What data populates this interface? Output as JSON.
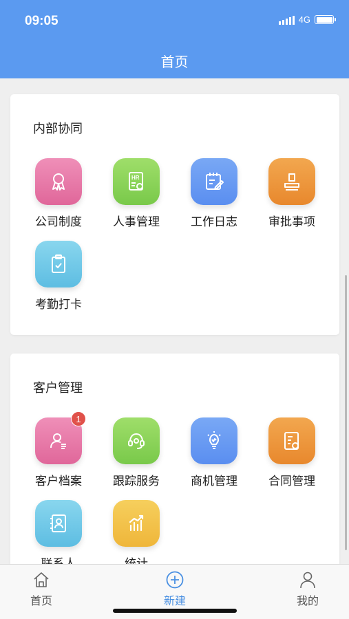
{
  "status_bar": {
    "time": "09:05",
    "network": "4G"
  },
  "header": {
    "title": "首页"
  },
  "sections": [
    {
      "title": "内部协同",
      "items": [
        {
          "label": "公司制度",
          "icon": "award-ribbon-icon",
          "color": "#e67aa8"
        },
        {
          "label": "人事管理",
          "icon": "hr-document-icon",
          "color": "#86d157"
        },
        {
          "label": "工作日志",
          "icon": "notepad-edit-icon",
          "color": "#689af2"
        },
        {
          "label": "审批事项",
          "icon": "stamp-icon",
          "color": "#ec963b"
        },
        {
          "label": "考勤打卡",
          "icon": "clipboard-check-icon",
          "color": "#72c9e8"
        }
      ]
    },
    {
      "title": "客户管理",
      "items": [
        {
          "label": "客户档案",
          "icon": "customer-profile-icon",
          "color": "#e67aa8",
          "badge": "1"
        },
        {
          "label": "跟踪服务",
          "icon": "headset-icon",
          "color": "#86d157"
        },
        {
          "label": "商机管理",
          "icon": "lightbulb-icon",
          "color": "#689af2"
        },
        {
          "label": "合同管理",
          "icon": "contract-document-icon",
          "color": "#ec963b"
        },
        {
          "label": "联系人",
          "icon": "contact-book-icon",
          "color": "#72c9e8"
        },
        {
          "label": "统计",
          "icon": "bar-chart-icon",
          "color": "#f2c24a"
        }
      ]
    }
  ],
  "tabbar": {
    "tabs": [
      {
        "label": "首页",
        "icon": "home-icon",
        "active": false
      },
      {
        "label": "新建",
        "icon": "plus-circle-icon",
        "active": true
      },
      {
        "label": "我的",
        "icon": "user-icon",
        "active": false
      }
    ],
    "active_color": "#4a90e2",
    "inactive_color": "#555555"
  }
}
